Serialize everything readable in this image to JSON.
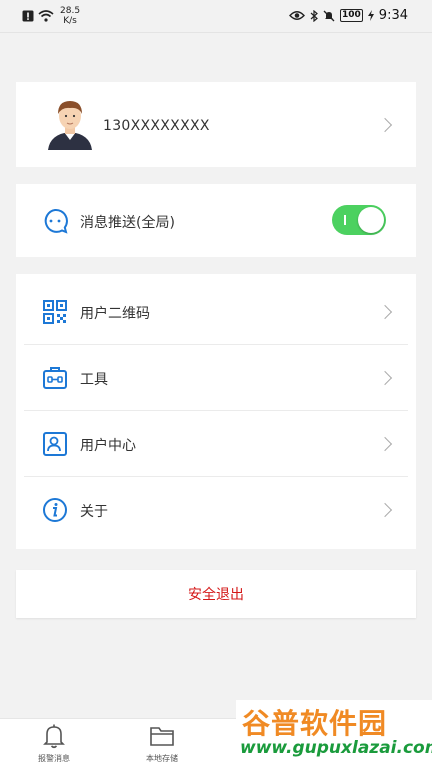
{
  "status_bar": {
    "net_speed": "28.5",
    "net_unit": "K/s",
    "battery": "100",
    "time": "9:34",
    "icons": [
      "alert-icon",
      "wifi-icon",
      "eye-icon",
      "bluetooth-icon",
      "mute-icon",
      "battery-icon",
      "charging-icon"
    ]
  },
  "profile": {
    "phone": "130XXXXXXXX"
  },
  "push": {
    "label": "消息推送(全局)",
    "enabled": true
  },
  "menu": {
    "items": [
      {
        "label": "用户二维码",
        "icon": "qr-code-icon"
      },
      {
        "label": "工具",
        "icon": "toolbox-icon"
      },
      {
        "label": "用户中心",
        "icon": "user-card-icon"
      },
      {
        "label": "关于",
        "icon": "info-icon"
      }
    ]
  },
  "logout": {
    "label": "安全退出"
  },
  "tabs": [
    {
      "label": "报警消息",
      "icon": "bell-icon"
    },
    {
      "label": "本地存储",
      "icon": "folder-icon"
    }
  ],
  "watermark": {
    "title": "谷普软件园",
    "url": "www.gupuxlazai.com"
  },
  "colors": {
    "accent": "#1d78d6",
    "toggle_on": "#4cd160",
    "logout": "#d41818"
  }
}
